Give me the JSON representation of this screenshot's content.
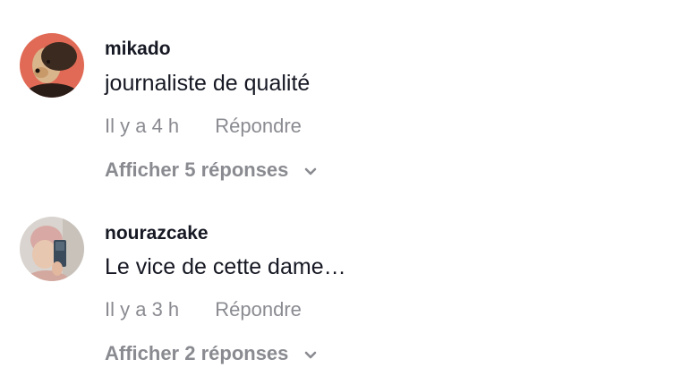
{
  "comments": [
    {
      "username": "mikado",
      "text": "journaliste de qualité",
      "time": "Il y a 4 h",
      "reply_label": "Répondre",
      "view_replies_label": "Afficher 5 réponses",
      "avatar_icon": "dog-avatar"
    },
    {
      "username": "nourazcake",
      "text": "Le vice de cette dame…",
      "time": "Il y a 3 h",
      "reply_label": "Répondre",
      "view_replies_label": "Afficher 2 réponses",
      "avatar_icon": "person-selfie-avatar"
    }
  ],
  "colors": {
    "username": "#161823",
    "text": "#161823",
    "meta": "#8a8b91",
    "background": "#ffffff"
  },
  "icons": {
    "expand": "chevron-down-icon"
  }
}
